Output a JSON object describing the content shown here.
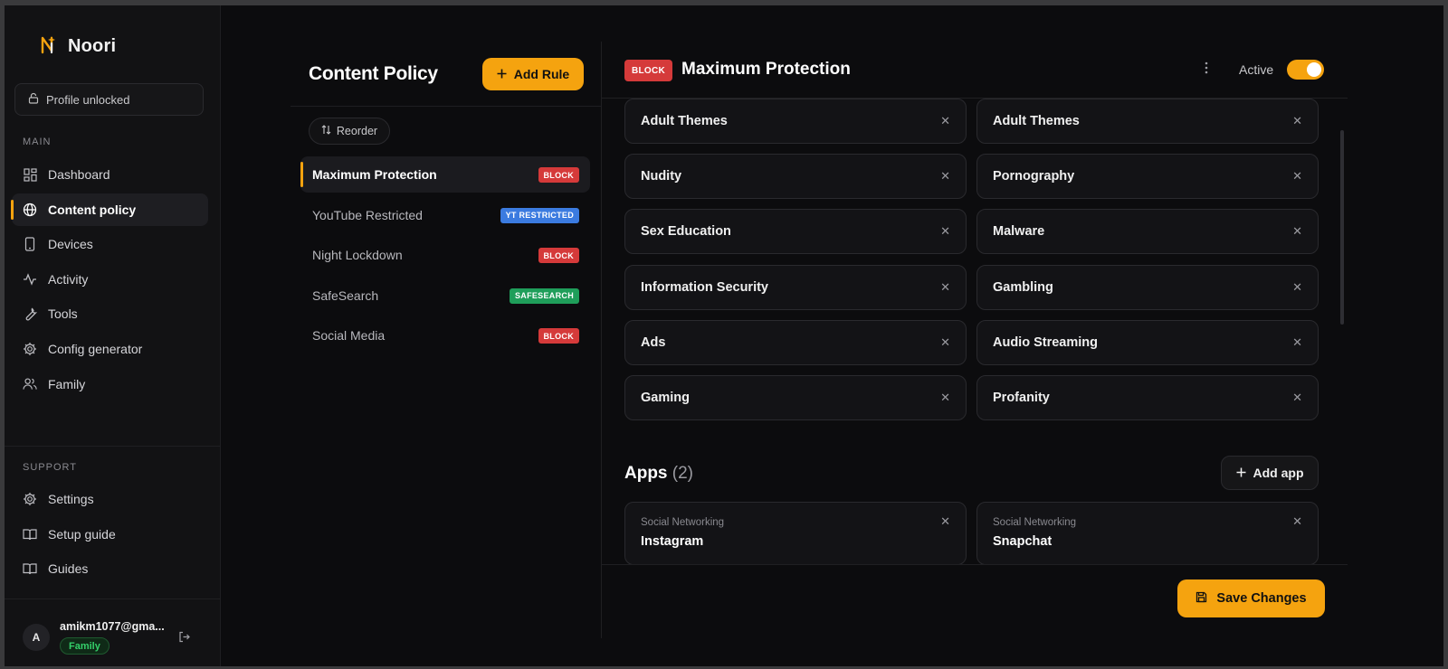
{
  "app": {
    "name": "Noori"
  },
  "sidebar": {
    "profile_status": "Profile unlocked",
    "main_label": "MAIN",
    "items": [
      {
        "label": "Dashboard",
        "icon": "dashboard-icon"
      },
      {
        "label": "Content policy",
        "icon": "globe-icon",
        "active": true
      },
      {
        "label": "Devices",
        "icon": "device-icon"
      },
      {
        "label": "Activity",
        "icon": "activity-icon"
      },
      {
        "label": "Tools",
        "icon": "wrench-icon"
      },
      {
        "label": "Config generator",
        "icon": "gear-icon"
      },
      {
        "label": "Family",
        "icon": "users-icon"
      }
    ],
    "support_label": "SUPPORT",
    "support_items": [
      {
        "label": "Settings",
        "icon": "gear-icon"
      },
      {
        "label": "Setup guide",
        "icon": "book-icon"
      },
      {
        "label": "Guides",
        "icon": "book-icon"
      }
    ],
    "user": {
      "initial": "A",
      "email": "amikm1077@gma...",
      "plan": "Family"
    }
  },
  "rules": {
    "title": "Content Policy",
    "add_rule_label": "Add Rule",
    "reorder_label": "Reorder",
    "items": [
      {
        "name": "Maximum Protection",
        "tag": "BLOCK",
        "tag_color": "#d53a3a",
        "active": true
      },
      {
        "name": "YouTube Restricted",
        "tag": "YT RESTRICTED",
        "tag_color": "#3b7be0"
      },
      {
        "name": "Night Lockdown",
        "tag": "BLOCK",
        "tag_color": "#d53a3a"
      },
      {
        "name": "SafeSearch",
        "tag": "SAFESEARCH",
        "tag_color": "#1f9e5a"
      },
      {
        "name": "Social Media",
        "tag": "BLOCK",
        "tag_color": "#d53a3a"
      }
    ]
  },
  "detail": {
    "tag": "BLOCK",
    "title": "Maximum Protection",
    "active_label": "Active",
    "active": true,
    "categories": [
      "Adult Themes",
      "Adult Themes",
      "Nudity",
      "Pornography",
      "Sex Education",
      "Malware",
      "Information Security",
      "Gambling",
      "Ads",
      "Audio Streaming",
      "Gaming",
      "Profanity"
    ],
    "apps_title": "Apps",
    "apps_count": "(2)",
    "add_app_label": "Add app",
    "apps": [
      {
        "category": "Social Networking",
        "name": "Instagram"
      },
      {
        "category": "Social Networking",
        "name": "Snapchat"
      }
    ],
    "save_label": "Save Changes"
  },
  "colors": {
    "accent": "#f5a30f",
    "block": "#d53a3a",
    "yt": "#3b7be0",
    "safesearch": "#1f9e5a"
  }
}
